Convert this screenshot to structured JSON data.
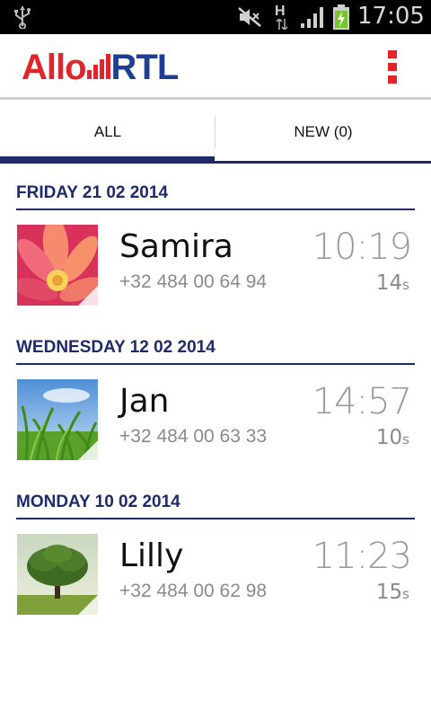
{
  "status_bar": {
    "time": "17:05",
    "network_label": "H",
    "icons": [
      "usb-icon",
      "mute-icon",
      "network-h-icon",
      "signal-icon",
      "battery-charging-icon"
    ]
  },
  "app_bar": {
    "logo_part1": "Allo",
    "logo_part2": "RTL",
    "menu_icon": "overflow-menu-icon",
    "brand_red": "#e2242b",
    "brand_blue": "#1d3e93"
  },
  "tabs": [
    {
      "label": "ALL",
      "active": true
    },
    {
      "label": "NEW (0)",
      "active": false
    }
  ],
  "accent_color": "#1f2a6b",
  "sections": [
    {
      "date": "FRIDAY 21 02 2014",
      "calls": [
        {
          "name": "Samira",
          "phone": "+32 484 00 64 94",
          "time": "10:19",
          "duration": "14",
          "duration_unit": "s",
          "thumbnail": "flower-photo"
        }
      ]
    },
    {
      "date": "WEDNESDAY 12 02 2014",
      "calls": [
        {
          "name": "Jan",
          "phone": "+32 484 00 63 33",
          "time": "14:57",
          "duration": "10",
          "duration_unit": "s",
          "thumbnail": "grass-photo"
        }
      ]
    },
    {
      "date": "MONDAY 10 02 2014",
      "calls": [
        {
          "name": "Lilly",
          "phone": "+32 484 00 62 98",
          "time": "11:23",
          "duration": "15",
          "duration_unit": "s",
          "thumbnail": "tree-photo"
        }
      ]
    }
  ]
}
